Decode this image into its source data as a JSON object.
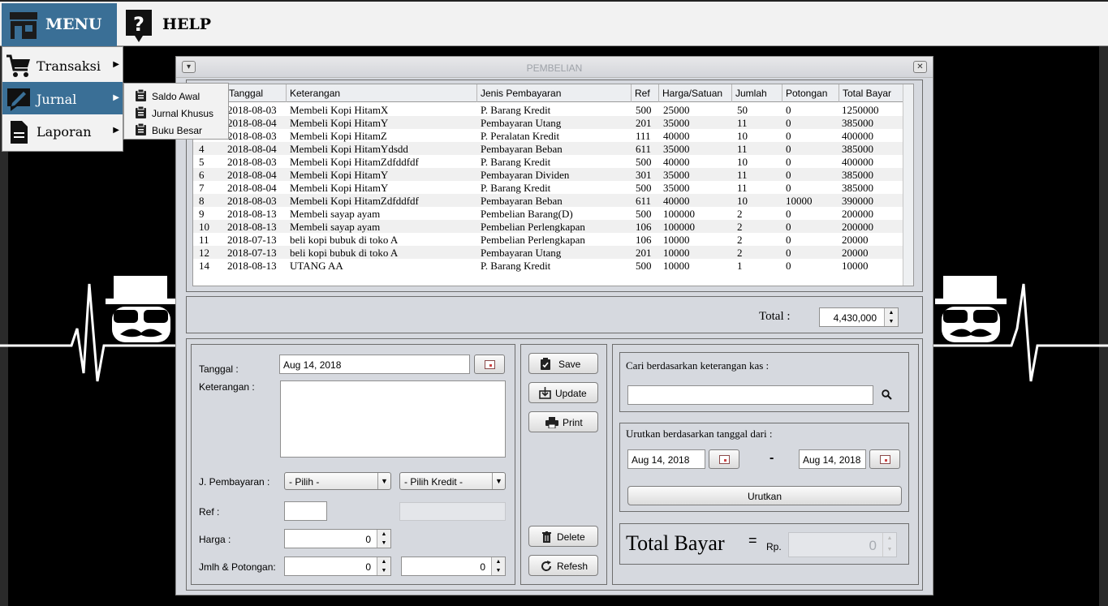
{
  "topbar": {
    "menu_label": "MENU",
    "help_label": "HELP"
  },
  "menu": {
    "items": [
      {
        "label": "Transaksi",
        "icon": "cart-icon"
      },
      {
        "label": "Jurnal",
        "icon": "pen-icon"
      },
      {
        "label": "Laporan",
        "icon": "document-icon"
      }
    ],
    "jurnal_submenu": [
      {
        "label": "Saldo Awal"
      },
      {
        "label": "Jurnal Khusus"
      },
      {
        "label": "Buku Besar"
      }
    ]
  },
  "dialog": {
    "title": "PEMBELIAN"
  },
  "table": {
    "columns": [
      "Tanggal",
      "Keterangan",
      "Jenis Pembayaran",
      "Ref",
      "Harga/Satuan",
      "Jumlah",
      "Potongan",
      "Total Bayar"
    ],
    "rows": [
      [
        "",
        "2018-08-03",
        "Membeli Kopi HitamX",
        "P. Barang Kredit",
        "500",
        "25000",
        "50",
        "0",
        "1250000"
      ],
      [
        "",
        "2018-08-04",
        "Membeli Kopi HitamY",
        "Pembayaran Utang",
        "201",
        "35000",
        "11",
        "0",
        "385000"
      ],
      [
        "",
        "2018-08-03",
        "Membeli Kopi HitamZ",
        "P. Peralatan Kredit",
        "111",
        "40000",
        "10",
        "0",
        "400000"
      ],
      [
        "4",
        "2018-08-04",
        "Membeli Kopi HitamYdsdd",
        "Pembayaran Beban",
        "611",
        "35000",
        "11",
        "0",
        "385000"
      ],
      [
        "5",
        "2018-08-03",
        "Membeli Kopi HitamZdfddfdf",
        "P. Barang Kredit",
        "500",
        "40000",
        "10",
        "0",
        "400000"
      ],
      [
        "6",
        "2018-08-04",
        "Membeli Kopi HitamY",
        "Pembayaran Dividen",
        "301",
        "35000",
        "11",
        "0",
        "385000"
      ],
      [
        "7",
        "2018-08-04",
        "Membeli Kopi HitamY",
        "P. Barang Kredit",
        "500",
        "35000",
        "11",
        "0",
        "385000"
      ],
      [
        "8",
        "2018-08-03",
        "Membeli Kopi HitamZdfddfdf",
        "Pembayaran Beban",
        "611",
        "40000",
        "10",
        "10000",
        "390000"
      ],
      [
        "9",
        "2018-08-13",
        "Membeli sayap ayam",
        "Pembelian Barang(D)",
        "500",
        "100000",
        "2",
        "0",
        "200000"
      ],
      [
        "10",
        "2018-08-13",
        "Membeli sayap ayam",
        "Pembelian Perlengkapan",
        "106",
        "100000",
        "2",
        "0",
        "200000"
      ],
      [
        "11",
        "2018-07-13",
        "beli kopi bubuk di toko A",
        "Pembelian Perlengkapan",
        "106",
        "10000",
        "2",
        "0",
        "20000"
      ],
      [
        "12",
        "2018-07-13",
        "beli kopi bubuk di toko A",
        "Pembayaran Utang",
        "201",
        "10000",
        "2",
        "0",
        "20000"
      ],
      [
        "14",
        "2018-08-13",
        "UTANG AA",
        "P. Barang Kredit",
        "500",
        "10000",
        "1",
        "0",
        "10000"
      ]
    ]
  },
  "total": {
    "label": "Total :",
    "value": "4,430,000"
  },
  "form": {
    "tanggal_label": "Tanggal :",
    "tanggal_value": "Aug 14, 2018",
    "keterangan_label": "Keterangan :",
    "pembayaran_label": "J. Pembayaran :",
    "pembayaran_select": "- Pilih -",
    "kredit_select": "- Pilih Kredit -",
    "ref_label": "Ref :",
    "harga_label": "Harga :",
    "harga_value": "0",
    "jmlh_label": "Jmlh & Potongan:",
    "jumlah_value": "0",
    "potongan_value": "0"
  },
  "actions": {
    "save": "Save",
    "update": "Update",
    "print": "Print",
    "delete": "Delete",
    "refresh": "Refesh"
  },
  "search": {
    "cari_label": "Cari berdasarkan keterangan kas :",
    "urutkan_label": "Urutkan berdasarkan tanggal dari :",
    "date_from": "Aug 14, 2018",
    "date_to": "Aug 14, 2018",
    "dash": "-",
    "urutkan_button": "Urutkan",
    "total_bayar_label": "Total Bayar",
    "equals": "=",
    "rp_label": "Rp.",
    "total_bayar_value": "0"
  }
}
